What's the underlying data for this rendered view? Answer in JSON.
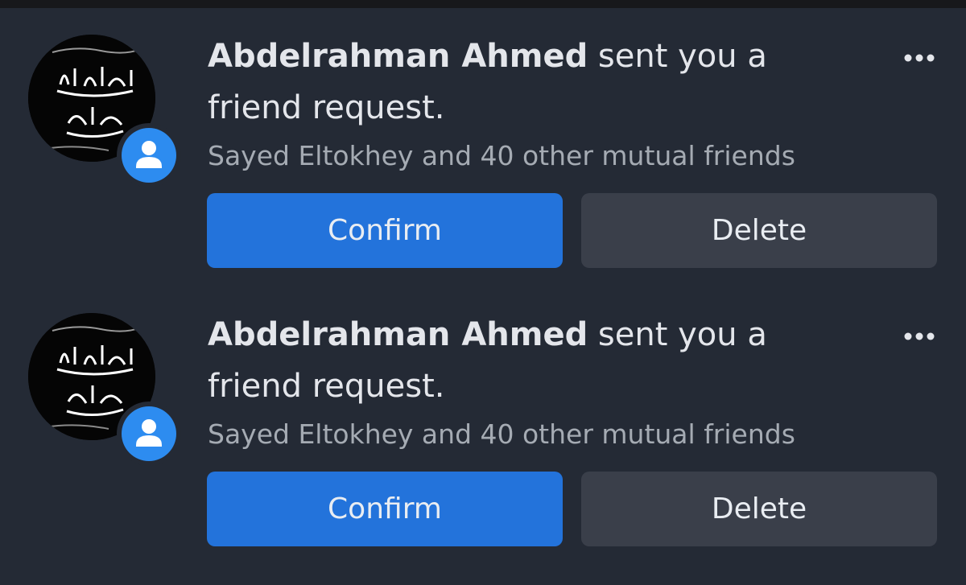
{
  "requests": [
    {
      "name": "Abdelrahman Ahmed",
      "action": " sent you a friend request.",
      "mutual": "Sayed Eltokhey and 40 other mutual friends",
      "confirm_label": "Confirm",
      "delete_label": "Delete",
      "more_icon": "more-horizontal-icon",
      "badge_icon": "person-icon"
    },
    {
      "name": "Abdelrahman Ahmed",
      "action": " sent you a friend request.",
      "mutual": "Sayed Eltokhey and 40 other mutual friends",
      "confirm_label": "Confirm",
      "delete_label": "Delete",
      "more_icon": "more-horizontal-icon",
      "badge_icon": "person-icon"
    }
  ],
  "colors": {
    "background": "#242a35",
    "confirm": "#2373db",
    "delete": "#3a3f4a",
    "badge": "#2d8cf0",
    "text_primary": "#e4e6eb",
    "text_secondary": "#a5abb3"
  }
}
